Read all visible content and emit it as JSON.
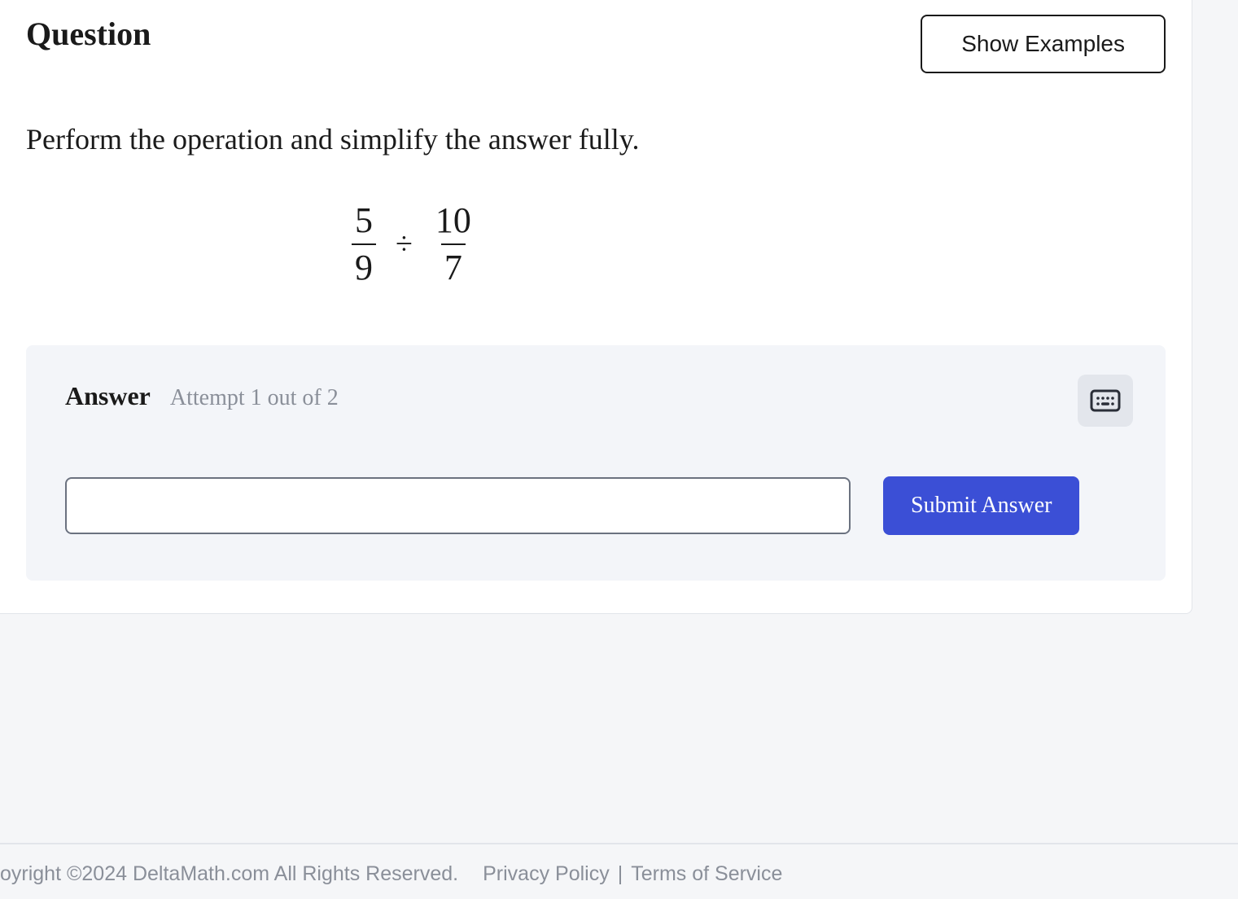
{
  "question": {
    "title": "Question",
    "show_examples_label": "Show Examples",
    "instruction": "Perform the operation and simplify the answer fully.",
    "expression": {
      "frac1_num": "5",
      "frac1_den": "9",
      "operator": "÷",
      "frac2_num": "10",
      "frac2_den": "7"
    }
  },
  "answer": {
    "label": "Answer",
    "attempt_text": "Attempt 1 out of 2",
    "input_value": "",
    "submit_label": "Submit Answer"
  },
  "footer": {
    "copyright": "oyright ©2024 DeltaMath.com All Rights Reserved.",
    "privacy": "Privacy Policy",
    "separator": "|",
    "terms": "Terms of Service"
  }
}
